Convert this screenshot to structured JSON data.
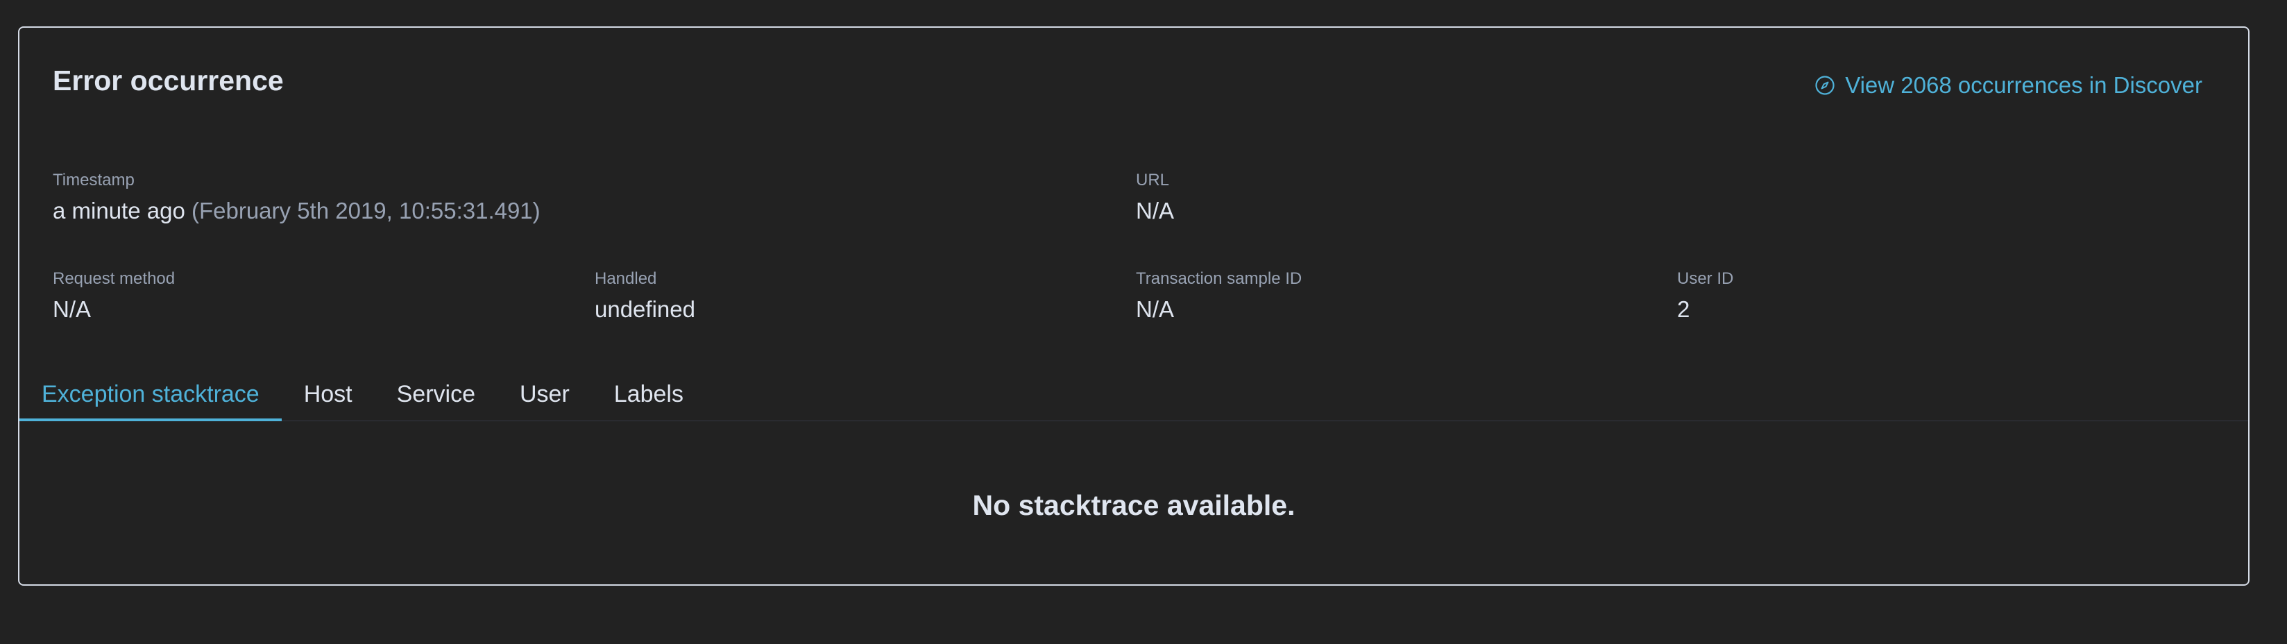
{
  "panel": {
    "title": "Error occurrence",
    "discover_link": {
      "icon": "compass-icon",
      "label": "View 2068 occurrences in Discover"
    }
  },
  "fields": {
    "timestamp": {
      "label": "Timestamp",
      "relative": "a minute ago",
      "absolute": "(February 5th 2019, 10:55:31.491)"
    },
    "url": {
      "label": "URL",
      "value": "N/A"
    },
    "request_method": {
      "label": "Request method",
      "value": "N/A"
    },
    "handled": {
      "label": "Handled",
      "value": "undefined"
    },
    "transaction_sample_id": {
      "label": "Transaction sample ID",
      "value": "N/A"
    },
    "user_id": {
      "label": "User ID",
      "value": "2"
    }
  },
  "tabs": [
    {
      "label": "Exception stacktrace",
      "selected": true
    },
    {
      "label": "Host",
      "selected": false
    },
    {
      "label": "Service",
      "selected": false
    },
    {
      "label": "User",
      "selected": false
    },
    {
      "label": "Labels",
      "selected": false
    }
  ],
  "empty_state": "No stacktrace available.",
  "colors": {
    "background": "#222222",
    "accent": "#4fb2d9",
    "text": "#dfe5ef",
    "muted": "#98a2b3",
    "border": "#d4dae5"
  }
}
